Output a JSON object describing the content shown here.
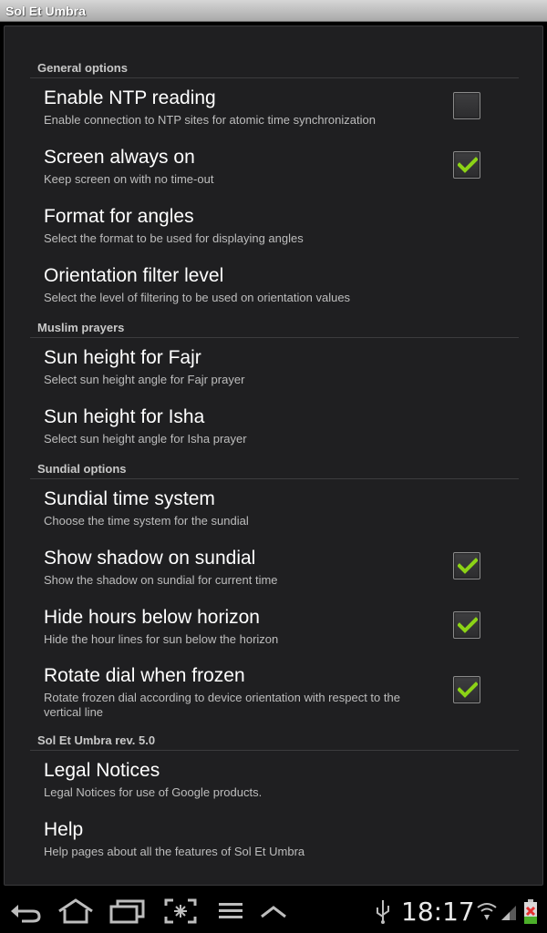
{
  "app": {
    "title": "Sol Et Umbra"
  },
  "sections": {
    "general": {
      "header": "General options",
      "items": [
        {
          "title": "Enable NTP reading",
          "summary": "Enable connection to NTP sites for atomic time synchronization",
          "checked": false
        },
        {
          "title": "Screen always on",
          "summary": "Keep screen on with no time-out",
          "checked": true
        },
        {
          "title": "Format for angles",
          "summary": "Select the format to be used for displaying angles"
        },
        {
          "title": "Orientation filter level",
          "summary": "Select the level of filtering to be used on orientation values"
        }
      ]
    },
    "muslim": {
      "header": "Muslim prayers",
      "items": [
        {
          "title": "Sun height for Fajr",
          "summary": "Select sun height angle for Fajr prayer"
        },
        {
          "title": "Sun height for Isha",
          "summary": "Select sun height angle for Isha prayer"
        }
      ]
    },
    "sundial": {
      "header": "Sundial options",
      "items": [
        {
          "title": "Sundial time system",
          "summary": "Choose the time system for the sundial"
        },
        {
          "title": "Show shadow on sundial",
          "summary": "Show the shadow on sundial for current time",
          "checked": true
        },
        {
          "title": "Hide hours below horizon",
          "summary": "Hide the hour lines for sun below the horizon",
          "checked": true
        },
        {
          "title": "Rotate dial when frozen",
          "summary": "Rotate frozen dial according to device orientation with respect to the vertical line",
          "checked": true
        }
      ]
    },
    "about": {
      "header": "Sol Et Umbra rev. 5.0",
      "items": [
        {
          "title": "Legal Notices",
          "summary": "Legal Notices for use of Google products."
        },
        {
          "title": "Help",
          "summary": "Help pages about all the features of Sol Et Umbra"
        }
      ]
    }
  },
  "statusbar": {
    "time": "18:17",
    "icons": [
      "usb-icon",
      "wifi-icon",
      "signal-icon",
      "battery-icon"
    ]
  },
  "navbar": {
    "buttons": [
      "back-icon",
      "home-icon",
      "recent-apps-icon",
      "screenshot-icon",
      "menu-icon",
      "up-arrow-icon"
    ]
  },
  "colors": {
    "accent_check": "#8cd316",
    "background": "#1f1f21"
  }
}
